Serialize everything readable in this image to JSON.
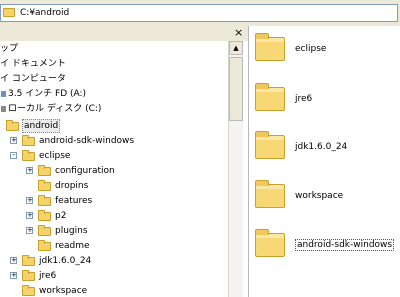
{
  "address_bar": {
    "path": "C:¥android"
  },
  "tree": {
    "close_glyph": "×",
    "items": [
      {
        "label": "ップ"
      },
      {
        "label": "イ ドキュメント"
      },
      {
        "label": "イ コンピュータ"
      },
      {
        "label": "3.5 インチ FD (A:)"
      },
      {
        "label": "ローカル ディスク (C:)"
      },
      {
        "label": "android"
      },
      {
        "label": "android-sdk-windows",
        "expander": "+"
      },
      {
        "label": "eclipse",
        "expander": "-"
      },
      {
        "label": "configuration",
        "expander": "+"
      },
      {
        "label": "dropins"
      },
      {
        "label": "features",
        "expander": "+"
      },
      {
        "label": "p2",
        "expander": "+"
      },
      {
        "label": "plugins",
        "expander": "+"
      },
      {
        "label": "readme"
      },
      {
        "label": "jdk1.6.0_24",
        "expander": "+"
      },
      {
        "label": "jre6",
        "expander": "+"
      },
      {
        "label": "workspace"
      }
    ]
  },
  "scrollbar": {
    "up_arrow": "▲"
  },
  "content": {
    "items": [
      {
        "label": "eclipse"
      },
      {
        "label": "jre6"
      },
      {
        "label": "jdk1.6.0_24"
      },
      {
        "label": "workspace"
      },
      {
        "label": "android-sdk-windows"
      }
    ]
  },
  "colors": {
    "folder": "#f5d36b",
    "folder_border": "#c9a12a",
    "chrome": "#ece9d8"
  }
}
